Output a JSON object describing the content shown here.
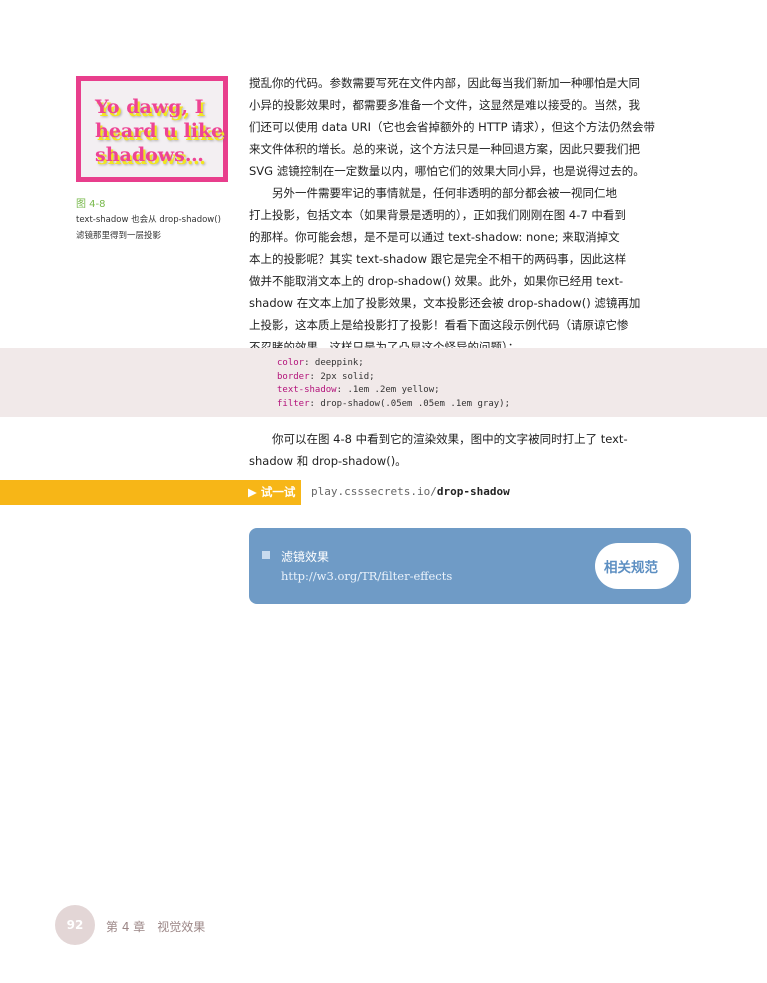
{
  "figure": {
    "image_text": "Yo dawg, I\nheard u like\nshadows…",
    "label": "图 4-8",
    "caption_lines": [
      "text-shadow 也会从 drop-shadow()",
      "滤镜那里得到一层投影"
    ]
  },
  "paragraphs": {
    "p1": [
      "搅乱你的代码。参数需要写死在文件内部，因此每当我们新加一种哪怕是大同",
      "小异的投影效果时，都需要多准备一个文件，这显然是难以接受的。当然，我",
      "们还可以使用 data URI（它也会省掉额外的 HTTP 请求），但这个方法仍然会带",
      "来文件体积的增长。总的来说，这个方法只是一种回退方案，因此只要我们把",
      "SVG 滤镜控制在一定数量以内，哪怕它们的效果大同小异，也是说得过去的。"
    ],
    "p2": [
      "　　另外一件需要牢记的事情就是，任何非透明的部分都会被一视同仁地",
      "打上投影，包括文本（如果背景是透明的），正如我们刚刚在图 4-7 中看到",
      "的那样。你可能会想，是不是可以通过 text-shadow: none; 来取消掉文",
      "本上的投影呢？其实 text-shadow 跟它是完全不相干的两码事，因此这样",
      "做并不能取消文本上的 drop-shadow() 效果。此外，如果你已经用 text-",
      "shadow 在文本上加了投影效果，文本投影还会被 drop-shadow() 滤镜再加",
      "上投影，这本质上是给投影打了投影！看看下面这段示例代码（请原谅它惨",
      "不忍睹的效果，这样只是为了凸显这个怪异的问题）："
    ],
    "p3": [
      "　　你可以在图 4-8 中看到它的渲染效果，图中的文字被同时打上了 text-",
      "shadow 和 drop-shadow()。"
    ]
  },
  "code": [
    {
      "prop": "color",
      "value": ": deeppink;"
    },
    {
      "prop": "border",
      "value": ": 2px solid;"
    },
    {
      "prop": "text-shadow",
      "value": ": .1em .2em yellow;"
    },
    {
      "prop": "filter",
      "value": ": drop-shadow(.05em .05em .1em gray);"
    }
  ],
  "try_it": {
    "label": "▶ 试一试",
    "url_prefix": "play.csssecrets.io/",
    "url_path": "drop-shadow"
  },
  "spec": {
    "title": "滤镜效果",
    "link": "http://w3.org/TR/filter-effects",
    "badge": "相关规范"
  },
  "footer": {
    "page_number": "92",
    "chapter": "第 4 章　视觉效果"
  },
  "colors": {
    "figure_border": "#e83e8c",
    "figure_text": "#ee4494",
    "figure_shadow": "#f2e51f",
    "code_band": "#f1e9e9",
    "try_bar": "#f7b617",
    "spec_box": "#6f9bc6",
    "caption_label": "#77b84a"
  }
}
